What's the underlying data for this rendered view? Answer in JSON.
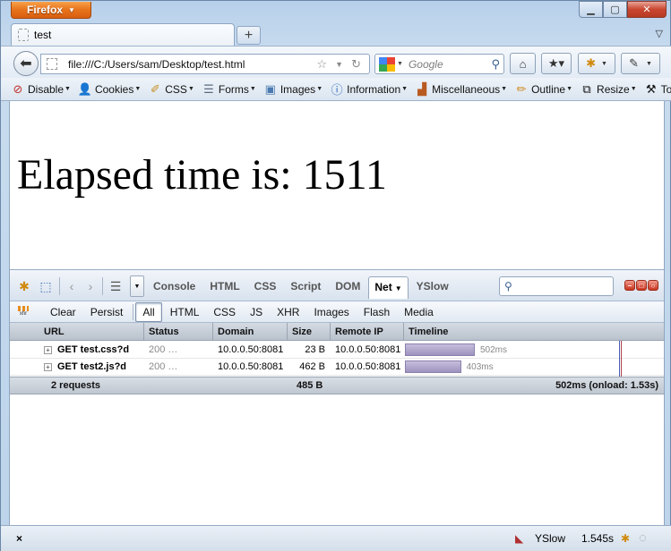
{
  "window": {
    "app_button": "Firefox",
    "minimize_icon": "minimize-icon",
    "maximize_icon": "maximize-icon",
    "close_icon": "close-icon"
  },
  "tabs": [
    {
      "title": "test"
    }
  ],
  "navbar": {
    "url": "file:///C:/Users/sam/Desktop/test.html",
    "search_placeholder": "Google"
  },
  "devtoolbar": {
    "items": [
      {
        "label": "Disable",
        "icon": "disable-icon",
        "color": "#c0302a"
      },
      {
        "label": "Cookies",
        "icon": "user-icon",
        "color": "#333333"
      },
      {
        "label": "CSS",
        "icon": "css-wand-icon",
        "color": "#c89020"
      },
      {
        "label": "Forms",
        "icon": "form-icon",
        "color": "#5a6a80"
      },
      {
        "label": "Images",
        "icon": "image-icon",
        "color": "#4a7ab0"
      },
      {
        "label": "Information",
        "icon": "info-icon",
        "color": "#1f5fb8"
      },
      {
        "label": "Miscellaneous",
        "icon": "misc-icon",
        "color": "#b85a20"
      },
      {
        "label": "Outline",
        "icon": "pencil-icon",
        "color": "#d08a20"
      },
      {
        "label": "Resize",
        "icon": "resize-icon",
        "color": "#333333"
      },
      {
        "label": "Tools",
        "icon": "tools-icon",
        "color": "#555555"
      }
    ]
  },
  "page": {
    "heading": "Elapsed time is: 1511"
  },
  "firebug": {
    "tabs": [
      "Console",
      "HTML",
      "CSS",
      "Script",
      "DOM",
      "Net",
      "YSlow"
    ],
    "active_tab": "Net",
    "net_filters": {
      "clear": "Clear",
      "persist": "Persist",
      "filters": [
        "All",
        "HTML",
        "CSS",
        "JS",
        "XHR",
        "Images",
        "Flash",
        "Media"
      ],
      "active": "All"
    },
    "columns": {
      "url": "URL",
      "status": "Status",
      "domain": "Domain",
      "size": "Size",
      "remote_ip": "Remote IP",
      "timeline": "Timeline"
    },
    "requests": [
      {
        "url": "GET test.css?d",
        "status": "200 …",
        "domain": "10.0.0.50:8081",
        "size": "23 B",
        "remote_ip": "10.0.0.50:8081",
        "time": "502ms",
        "start_ms": 0,
        "duration_ms": 502
      },
      {
        "url": "GET test2.js?d",
        "status": "200 …",
        "domain": "10.0.0.50:8081",
        "size": "462 B",
        "remote_ip": "10.0.0.50:8081",
        "time": "403ms",
        "start_ms": 0,
        "duration_ms": 403
      }
    ],
    "summary": {
      "count": "2 requests",
      "size": "485 B",
      "time": "502ms (onload: 1.53s)"
    }
  },
  "statusbar": {
    "close": "×",
    "yslow": "YSlow",
    "time": "1.545s"
  }
}
